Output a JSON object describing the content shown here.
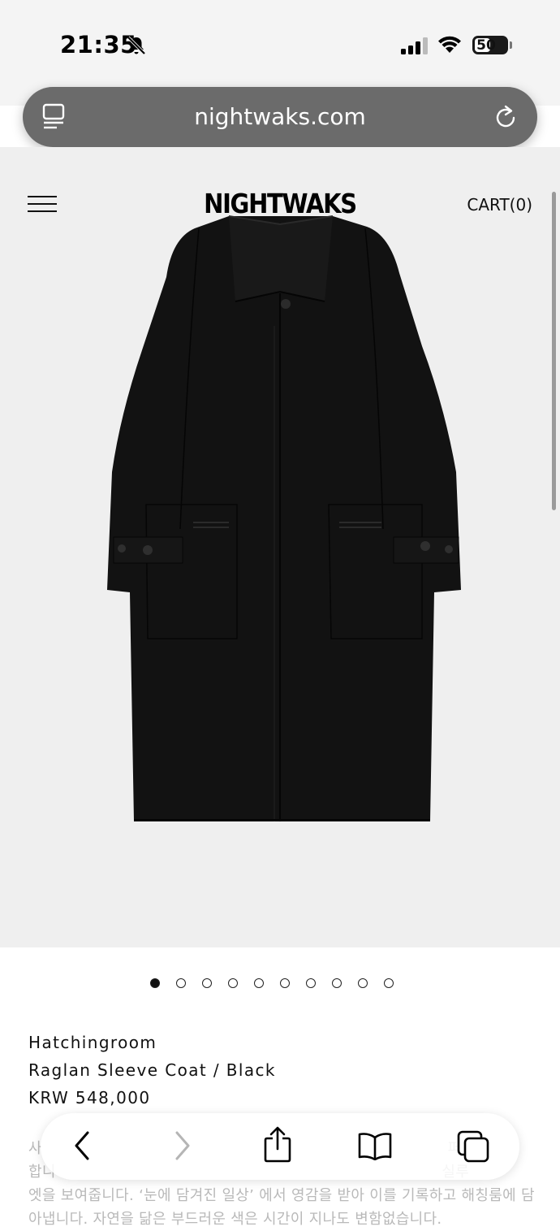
{
  "status": {
    "time": "21:35",
    "battery": "50"
  },
  "browser": {
    "url": "nightwaks.com"
  },
  "site": {
    "logo": "NIGHTWAKS",
    "cart_label": "CART(0)"
  },
  "carousel": {
    "count": 10,
    "active_index": 0
  },
  "product": {
    "brand": "Hatchingroom",
    "name": "Raglan Sleeve Coat / Black",
    "price": "KRW 548,000"
  },
  "description": {
    "line1": "사                                                                                   퍼",
    "line2": "합니                                                                               실루",
    "line3": "엣을 보여줍니다. ‘눈에 담겨진 일상’ 에서 영감을 받아 이를 기록하고 해칭룸에 담",
    "line4": "아냅니다. 자연을 닮은 부드러운 색은 시간이 지나도 변함없습니다."
  },
  "icons": {
    "status": [
      "bell-slash-icon",
      "signal-icon",
      "wifi-icon",
      "battery-icon"
    ],
    "url_bar": [
      "tabs-icon",
      "reload-icon"
    ],
    "toolbar": [
      "back-icon",
      "forward-icon",
      "share-icon",
      "bookmarks-icon",
      "tabs-overview-icon"
    ]
  }
}
